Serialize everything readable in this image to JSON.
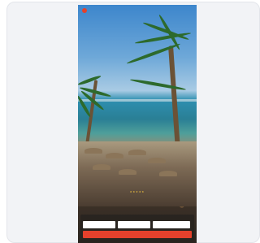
{
  "colors": {
    "accent": "#e4412c",
    "card_background": "#f2f3f6"
  },
  "header": {
    "logo_icon": "brand-logo-icon",
    "nav": [
      "",
      "",
      ""
    ],
    "right": [
      "",
      ""
    ]
  },
  "hero": {
    "rating_stars": 5,
    "stars_text": "★★★★★",
    "headline": "",
    "subline": ""
  },
  "booking": {
    "title": "",
    "link": "",
    "fields": [
      {
        "label": "",
        "value": ""
      },
      {
        "label": "",
        "value": ""
      },
      {
        "label": "",
        "value": ""
      }
    ],
    "cta_label": ""
  }
}
